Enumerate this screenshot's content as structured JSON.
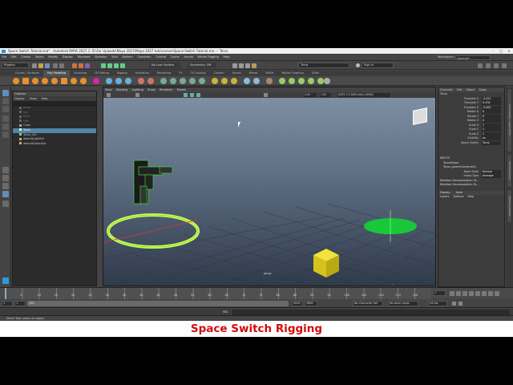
{
  "window": {
    "title": "Space Switch Tutorial.ma* - Autodesk MAYA 2027.1: D:\\For Uploads\\Maya 2027\\Maya 2027 tuts\\scenes\\Space Switch Tutorial.ma  ---  Torus"
  },
  "menubar": {
    "items": [
      "File",
      "Edit",
      "Create",
      "Select",
      "Modify",
      "Display",
      "Windows",
      "Skeleton",
      "Skin",
      "Deform",
      "Constrain",
      "Control",
      "Cache",
      "Arnold",
      "Bifrost Rigging",
      "Help"
    ],
    "workspace_label": "Workspace:",
    "workspace_value": "General*"
  },
  "statusline": {
    "menuset": "Rigging",
    "live_surface": "No Live Surface",
    "symmetry": "Symmetry: Off",
    "search_value": "Torus",
    "sign_in": "Sign In"
  },
  "shelf": {
    "tabs": [
      "Curves / Surfaces",
      "Poly Modeling",
      "Sculpting",
      "UV Editing",
      "Rigging",
      "Animation",
      "Rendering",
      "FX",
      "FX Caching",
      "Custom",
      "Arnold",
      "Bifrost",
      "MASH",
      "Motion Graphics",
      "XGen"
    ],
    "active_tab": "Poly Modeling"
  },
  "outliner": {
    "title": "Outliner",
    "menu": [
      "Display",
      "Show",
      "Help"
    ],
    "items": [
      {
        "label": "persp",
        "dim": true
      },
      {
        "label": "top",
        "dim": true
      },
      {
        "label": "front",
        "dim": true
      },
      {
        "label": "side",
        "dim": true
      },
      {
        "label": "Cube",
        "dim": false
      },
      {
        "label": "Torus",
        "dim": false,
        "selected": true
      },
      {
        "label": "Torus_Ctrl",
        "dim": false
      },
      {
        "label": "defaultLightSet",
        "dim": false
      },
      {
        "label": "defaultObjectSet",
        "dim": false
      }
    ]
  },
  "viewport": {
    "menu": [
      "View",
      "Shading",
      "Lighting",
      "Show",
      "Renderer",
      "Panels"
    ],
    "field_a": "0.00",
    "field_b": "1.00",
    "colorspace": "ACES 1.0 SDR-video (sRGB)",
    "camera_label": "persp"
  },
  "channelbox": {
    "tabs": [
      "Channels",
      "Edit",
      "Object",
      "Show"
    ],
    "object_name": "Torus",
    "attributes": [
      {
        "label": "Translate X",
        "value": "-0.022"
      },
      {
        "label": "Translate Y",
        "value": "9.476"
      },
      {
        "label": "Translate Z",
        "value": "-0.002"
      },
      {
        "label": "Rotate X",
        "value": "0"
      },
      {
        "label": "Rotate Y",
        "value": "0"
      },
      {
        "label": "Rotate Z",
        "value": "0"
      },
      {
        "label": "Scale X",
        "value": "1"
      },
      {
        "label": "Scale Y",
        "value": "1"
      },
      {
        "label": "Scale Z",
        "value": "1"
      },
      {
        "label": "Visibility",
        "value": "on"
      },
      {
        "label": "Space Switch",
        "value": "Torus"
      }
    ],
    "inputs_header": "INPUTS",
    "shape_header": "TorusShape",
    "constraint_name": "Torus_parentConstraint1",
    "node_state_label": "Node State",
    "node_state_value": "Normal",
    "interp_label": "Interp Type",
    "interp_value": "Average",
    "rot_decomp_1": "Rotation Decomposition Ta...",
    "rot_decomp_2": "Rotation Decomposition Ta...",
    "layer_tabs": [
      "Display",
      "Anim"
    ],
    "layer_menu": [
      "Layers",
      "Options",
      "Help"
    ]
  },
  "sidetabs": [
    "Channel Box / Layer Editor",
    "Attribute Editor",
    "Modeling Toolkit"
  ],
  "timeline": {
    "ticks": [
      "5",
      "10",
      "15",
      "20",
      "25",
      "30",
      "35",
      "40",
      "45",
      "50",
      "55",
      "60",
      "65",
      "70",
      "75",
      "80",
      "85",
      "90",
      "95",
      "100",
      "105",
      "110",
      "115",
      "120"
    ],
    "current_frame": "1"
  },
  "range": {
    "start": "1",
    "playback_start": "1",
    "range_label": "120",
    "playback_end": "2000",
    "end": "2660",
    "character_set": "No Character Set",
    "anim_layer": "No Anim Layer",
    "fps": "24 fps"
  },
  "mel": {
    "label": "MEL"
  },
  "helpline": {
    "text": "Select Tool: select an object"
  },
  "caption": {
    "text": "Space Switch Rigging"
  },
  "colors": {
    "caption_red": "#d10b0b",
    "selection_blue": "#5285a6",
    "torus_green": "#c8ff55",
    "cube_yellow": "#e6d319",
    "cylinder_blue": "#2a8ae6",
    "sphere_red": "#e03040",
    "disc_green": "#19c83a"
  }
}
